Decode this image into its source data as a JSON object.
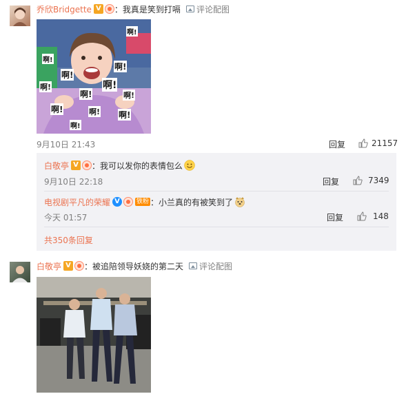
{
  "comments": [
    {
      "username": "乔欣Bridgette",
      "text": "：我真是笑到打嗝",
      "pic_link": "评论配图",
      "date": "9月10日 21:43",
      "reply": "回复",
      "likes": "21157",
      "image_text": "啊!"
    },
    {
      "username": "白敬亭",
      "text": "：被追陪领导妖娆的第二天",
      "pic_link": "评论配图"
    }
  ],
  "replies": [
    {
      "username": "白敬亭",
      "text": "：我可以发你的表情包么",
      "date": "9月10日 22:18",
      "reply": "回复",
      "likes": "7349"
    },
    {
      "username": "电视剧平凡的荣耀",
      "badge": "铁粉",
      "text": "：小兰真的有被笑到了",
      "date": "今天 01:57",
      "reply": "回复",
      "likes": "148"
    }
  ],
  "more_replies": "共350条回复",
  "colors": {
    "link": "#eb7350",
    "verified": "#f5a623",
    "blue_v": "#1e90ff",
    "reply_bg": "#f2f2f5"
  },
  "icons": [
    "verified-badge-icon",
    "fan-badge-icon",
    "picture-icon",
    "thumbs-up-icon",
    "smile-emoji-icon",
    "dog-emoji-icon"
  ]
}
